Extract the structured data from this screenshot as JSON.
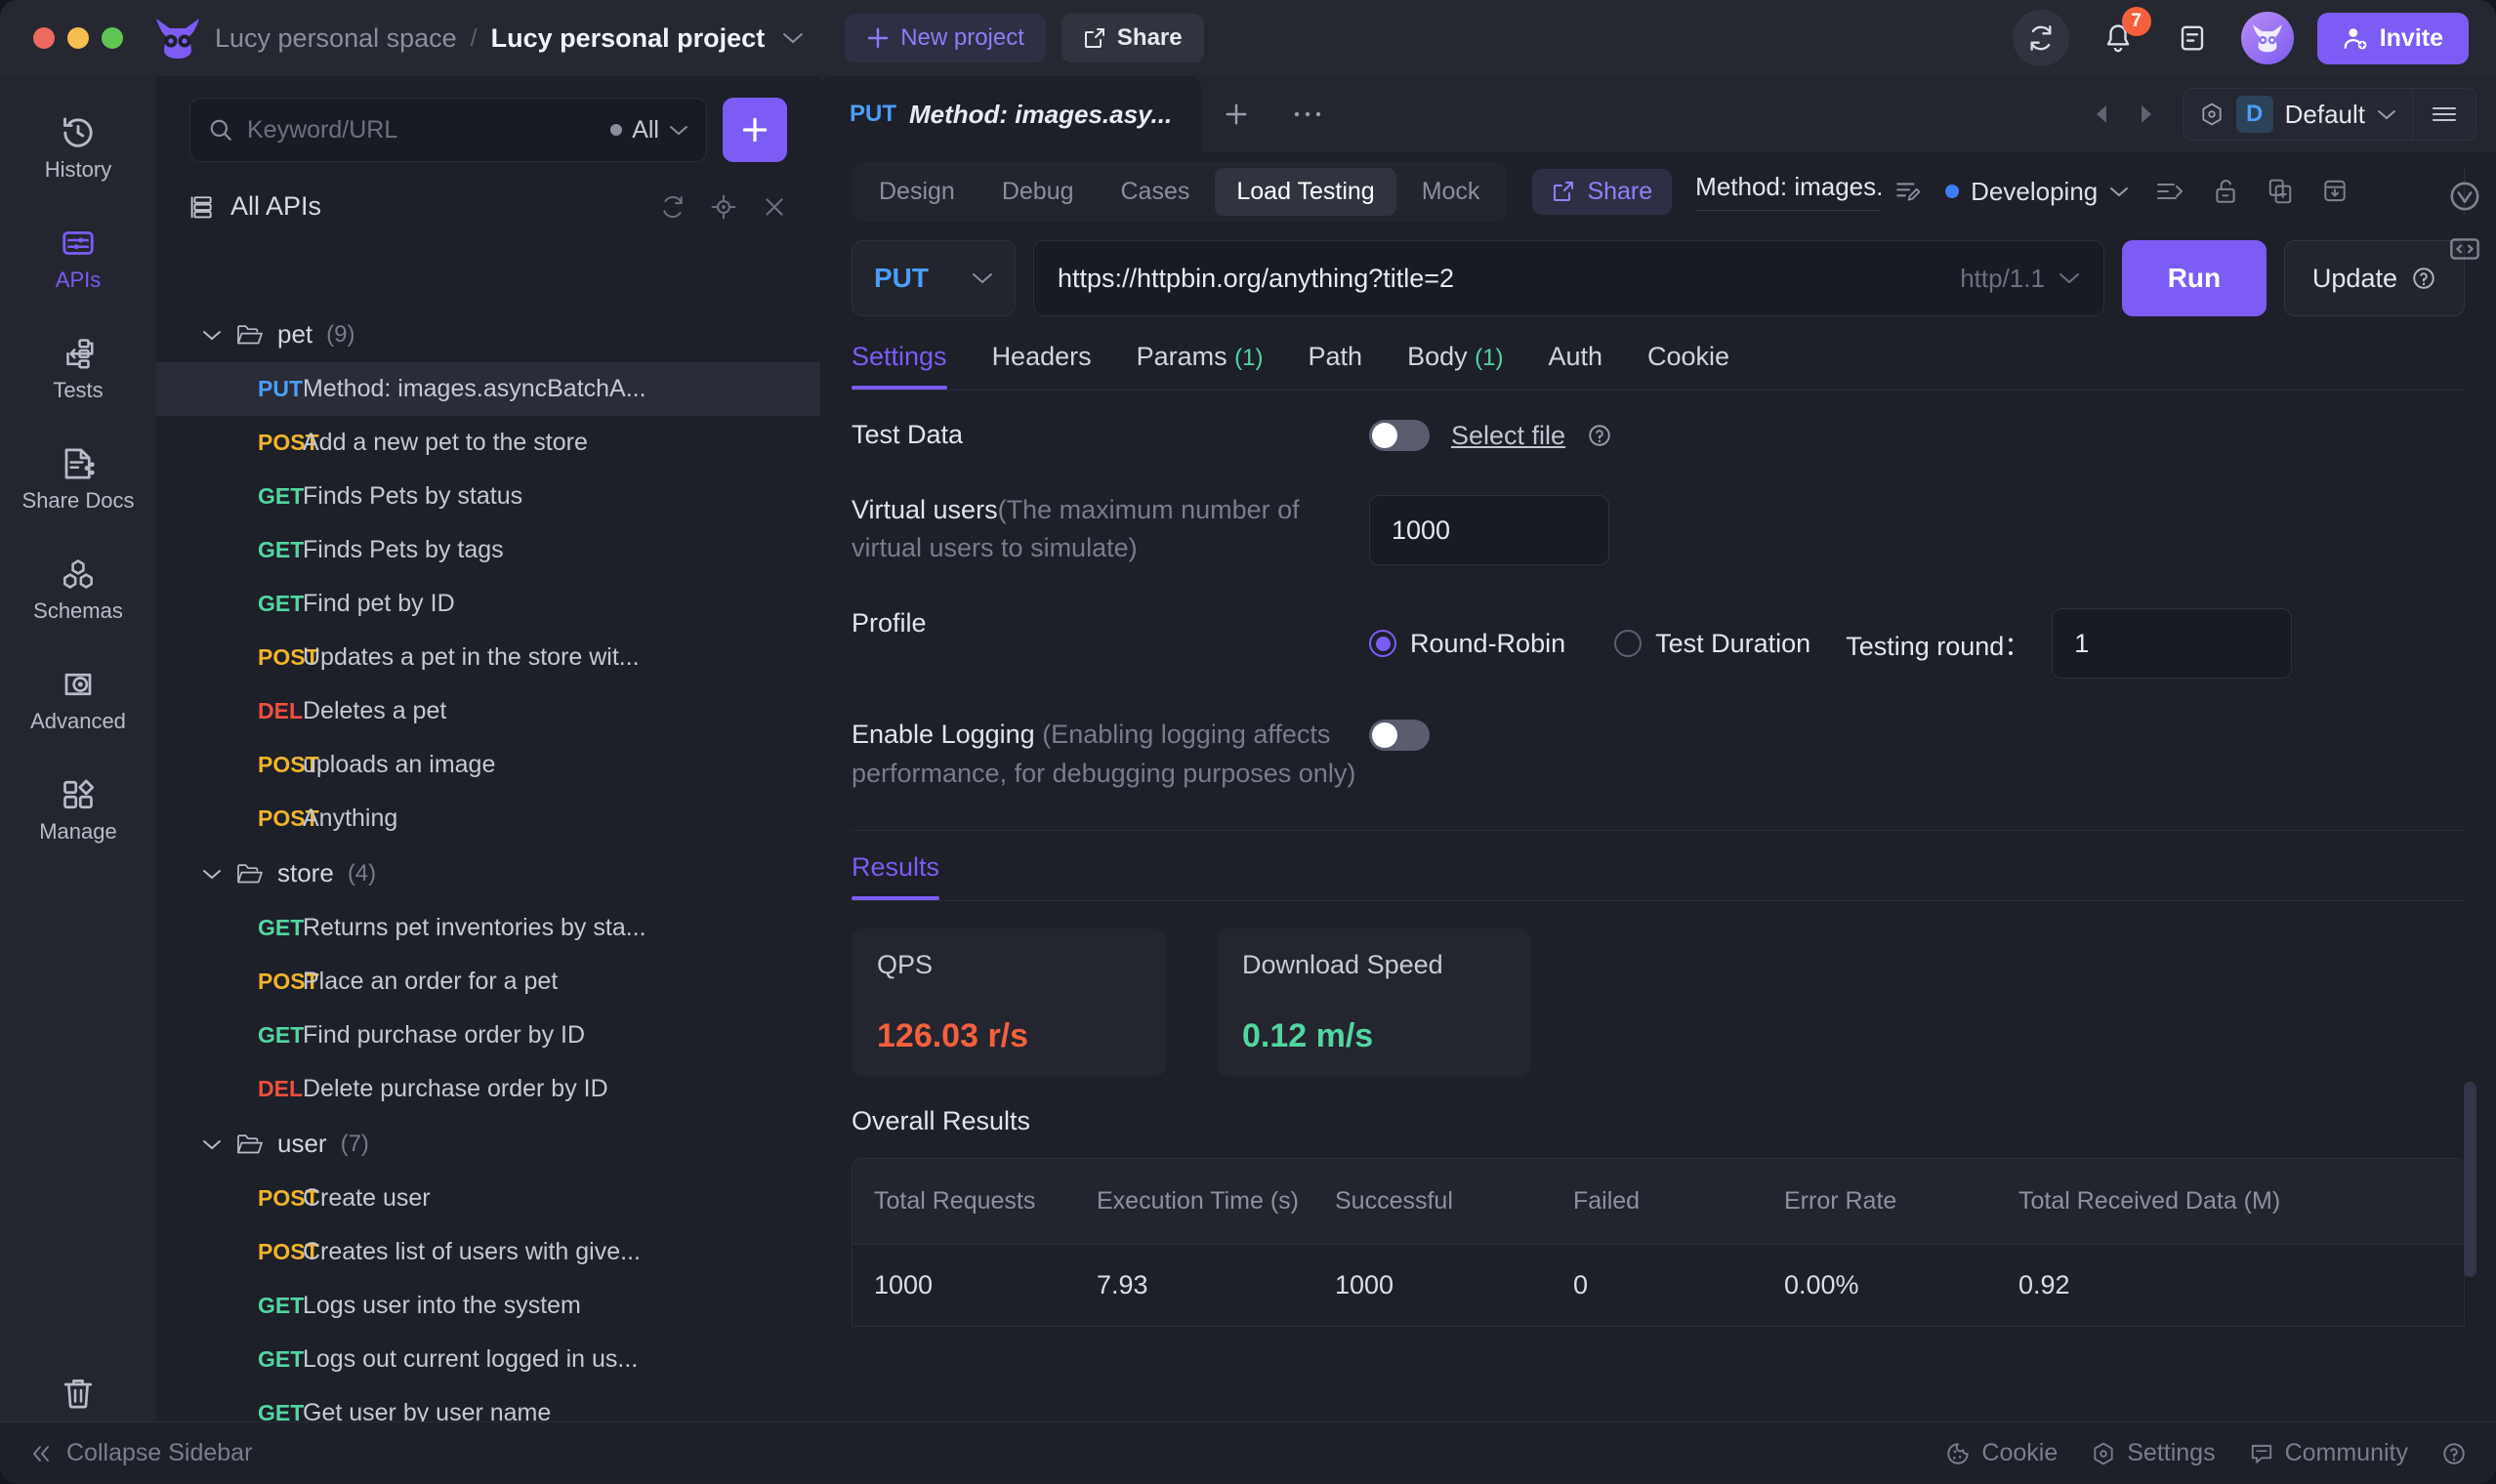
{
  "titlebar": {
    "space": "Lucy personal space",
    "separator": "/",
    "project": "Lucy personal project",
    "new_project_label": "New project",
    "share_label": "Share",
    "notification_count": "7",
    "invite_label": "Invite"
  },
  "rail": {
    "items": [
      {
        "label": "History",
        "icon": "history-icon",
        "active": false
      },
      {
        "label": "APIs",
        "icon": "apis-icon",
        "active": true
      },
      {
        "label": "Tests",
        "icon": "tests-icon",
        "active": false
      },
      {
        "label": "Share Docs",
        "icon": "share-docs-icon",
        "active": false
      },
      {
        "label": "Schemas",
        "icon": "schemas-icon",
        "active": false
      },
      {
        "label": "Advanced",
        "icon": "advanced-icon",
        "active": false
      },
      {
        "label": "Manage",
        "icon": "manage-icon",
        "active": false
      }
    ],
    "trash_label": "Trash"
  },
  "listpanel": {
    "search_placeholder": "Keyword/URL",
    "filter_label": "All",
    "all_apis_label": "All APIs",
    "folders": [
      {
        "name": "pet",
        "count": "(9)",
        "apis": [
          {
            "method": "PUT",
            "title": "Method: images.asyncBatchA...",
            "selected": true
          },
          {
            "method": "POST",
            "title": "Add a new pet to the store",
            "selected": false
          },
          {
            "method": "GET",
            "title": "Finds Pets by status",
            "selected": false
          },
          {
            "method": "GET",
            "title": "Finds Pets by tags",
            "selected": false
          },
          {
            "method": "GET",
            "title": "Find pet by ID",
            "selected": false
          },
          {
            "method": "POST",
            "title": "Updates a pet in the store wit...",
            "selected": false
          },
          {
            "method": "DEL",
            "title": "Deletes a pet",
            "selected": false
          },
          {
            "method": "POST",
            "title": "uploads an image",
            "selected": false
          },
          {
            "method": "POST",
            "title": "Anything",
            "selected": false
          }
        ]
      },
      {
        "name": "store",
        "count": "(4)",
        "apis": [
          {
            "method": "GET",
            "title": "Returns pet inventories by sta...",
            "selected": false
          },
          {
            "method": "POST",
            "title": "Place an order for a pet",
            "selected": false
          },
          {
            "method": "GET",
            "title": "Find purchase order by ID",
            "selected": false
          },
          {
            "method": "DEL",
            "title": "Delete purchase order by ID",
            "selected": false
          }
        ]
      },
      {
        "name": "user",
        "count": "(7)",
        "apis": [
          {
            "method": "POST",
            "title": "Create user",
            "selected": false
          },
          {
            "method": "POST",
            "title": "Creates list of users with give...",
            "selected": false
          },
          {
            "method": "GET",
            "title": "Logs user into the system",
            "selected": false
          },
          {
            "method": "GET",
            "title": "Logs out current logged in us...",
            "selected": false
          },
          {
            "method": "GET",
            "title": "Get user by user name",
            "selected": false
          }
        ]
      }
    ]
  },
  "main": {
    "doc_tab": {
      "method": "PUT",
      "title": "Method: images.asy..."
    },
    "env": {
      "letter": "D",
      "name": "Default"
    },
    "segtabs": [
      {
        "label": "Design",
        "active": false
      },
      {
        "label": "Debug",
        "active": false
      },
      {
        "label": "Cases",
        "active": false
      },
      {
        "label": "Load Testing",
        "active": true
      },
      {
        "label": "Mock",
        "active": false
      }
    ],
    "share_label": "Share",
    "api_name": "Method: images.as",
    "status_label": "Developing",
    "request": {
      "method": "PUT",
      "url": "https://httpbin.org/anything?title=2",
      "protocol": "http/1.1",
      "run_label": "Run",
      "update_label": "Update"
    },
    "settabs": [
      {
        "label": "Settings",
        "count": "",
        "active": true
      },
      {
        "label": "Headers",
        "count": "",
        "active": false
      },
      {
        "label": "Params",
        "count": "(1)",
        "active": false
      },
      {
        "label": "Path",
        "count": "",
        "active": false
      },
      {
        "label": "Body",
        "count": "(1)",
        "active": false
      },
      {
        "label": "Auth",
        "count": "",
        "active": false
      },
      {
        "label": "Cookie",
        "count": "",
        "active": false
      }
    ],
    "form": {
      "test_data_label": "Test Data",
      "select_file_label": "Select file",
      "virtual_users_label": "Virtual users",
      "virtual_users_hint": "(The maximum number of virtual users to simulate)",
      "virtual_users_value": "1000",
      "profile_label": "Profile",
      "profile_option_1": "Round-Robin",
      "profile_option_2": "Test Duration",
      "testing_round_label": "Testing round：",
      "testing_round_value": "1",
      "enable_logging_label": "Enable Logging",
      "enable_logging_hint": "(Enabling logging affects performance, for debugging purposes only)"
    },
    "results": {
      "tab_label": "Results",
      "cards": [
        {
          "title": "QPS",
          "value": "126.03 r/s",
          "color": "#f4603c"
        },
        {
          "title": "Download Speed",
          "value": "0.12 m/s",
          "color": "#52d6a0"
        }
      ],
      "overall_title": "Overall Results",
      "table": {
        "headers": [
          "Total Requests",
          "Execution Time (s)",
          "Successful",
          "Failed",
          "Error Rate",
          "Total Received Data (M)"
        ],
        "rows": [
          [
            "1000",
            "7.93",
            "1000",
            "0",
            "0.00%",
            "0.92"
          ]
        ]
      }
    }
  },
  "statusbar": {
    "collapse_label": "Collapse Sidebar",
    "items": [
      {
        "label": "Cookie",
        "icon": "cookie-icon"
      },
      {
        "label": "Settings",
        "icon": "gear-icon"
      },
      {
        "label": "Community",
        "icon": "community-icon"
      }
    ]
  }
}
